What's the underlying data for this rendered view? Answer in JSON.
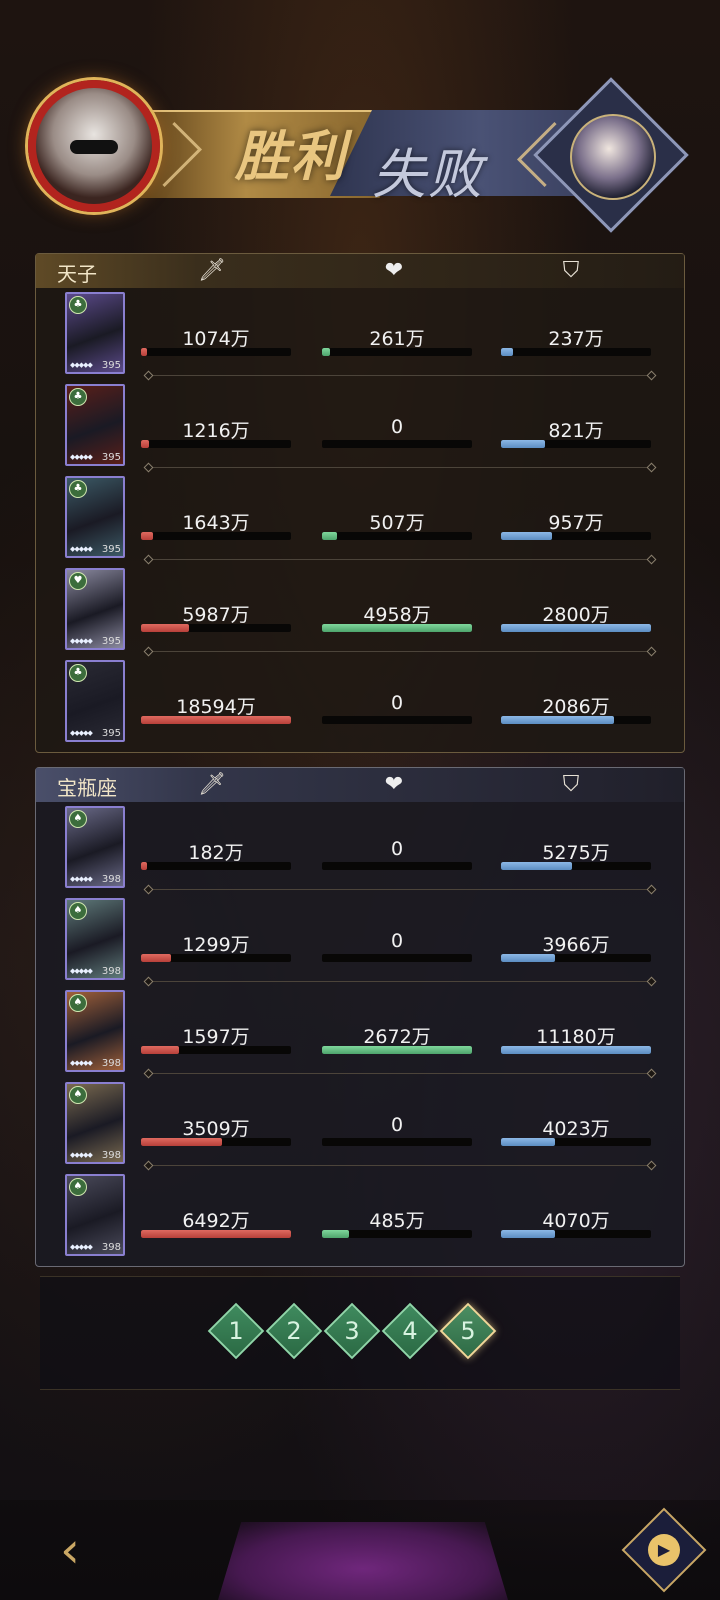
{
  "header": {
    "victory_label": "胜利",
    "defeat_label": "失败",
    "left_avatar": "player-avatar-sunglasses",
    "right_avatar": "opponent-avatar"
  },
  "columns": {
    "damage_icon": "sword-icon",
    "heal_icon": "heart-icon",
    "tank_icon": "shield-icon"
  },
  "teams": [
    {
      "name": "天子",
      "theme": "gold",
      "members": [
        {
          "card_color": "#5b4a8a",
          "badge": "♣",
          "level": "395",
          "damage": "1074万",
          "damage_pct": 4,
          "heal": "261万",
          "heal_pct": 5,
          "tank": "237万",
          "tank_pct": 8
        },
        {
          "card_color": "#5a1f1a",
          "badge": "♣",
          "level": "395",
          "damage": "1216万",
          "damage_pct": 5,
          "heal": "0",
          "heal_pct": 0,
          "tank": "821万",
          "tank_pct": 29
        },
        {
          "card_color": "#3c5a66",
          "badge": "♣",
          "level": "395",
          "damage": "1643万",
          "damage_pct": 8,
          "heal": "507万",
          "heal_pct": 10,
          "tank": "957万",
          "tank_pct": 34
        },
        {
          "card_color": "#8b8aa0",
          "badge": "♥",
          "level": "395",
          "damage": "5987万",
          "damage_pct": 32,
          "heal": "4958万",
          "heal_pct": 100,
          "tank": "2800万",
          "tank_pct": 100
        },
        {
          "card_color": "#2a2a34",
          "badge": "♣",
          "level": "395",
          "damage": "18594万",
          "damage_pct": 100,
          "heal": "0",
          "heal_pct": 0,
          "tank": "2086万",
          "tank_pct": 75
        }
      ]
    },
    {
      "name": "宝瓶座",
      "theme": "blue",
      "members": [
        {
          "card_color": "#6a6a88",
          "badge": "♠",
          "level": "398",
          "damage": "182万",
          "damage_pct": 3,
          "heal": "0",
          "heal_pct": 0,
          "tank": "5275万",
          "tank_pct": 47
        },
        {
          "card_color": "#5f7a7a",
          "badge": "♠",
          "level": "398",
          "damage": "1299万",
          "damage_pct": 20,
          "heal": "0",
          "heal_pct": 0,
          "tank": "3966万",
          "tank_pct": 36
        },
        {
          "card_color": "#a0603a",
          "badge": "♠",
          "level": "398",
          "damage": "1597万",
          "damage_pct": 25,
          "heal": "2672万",
          "heal_pct": 100,
          "tank": "11180万",
          "tank_pct": 100
        },
        {
          "card_color": "#7a6a50",
          "badge": "♠",
          "level": "398",
          "damage": "3509万",
          "damage_pct": 54,
          "heal": "0",
          "heal_pct": 0,
          "tank": "4023万",
          "tank_pct": 36
        },
        {
          "card_color": "#4a4a5a",
          "badge": "♠",
          "level": "398",
          "damage": "6492万",
          "damage_pct": 100,
          "heal": "485万",
          "heal_pct": 18,
          "tank": "4070万",
          "tank_pct": 36
        }
      ]
    }
  ],
  "pager": {
    "pages": [
      "1",
      "2",
      "3",
      "4",
      "5"
    ],
    "active_index": 4
  },
  "bottom": {
    "back_icon": "back-arrow-icon",
    "replay_icon": "replay-icon"
  }
}
